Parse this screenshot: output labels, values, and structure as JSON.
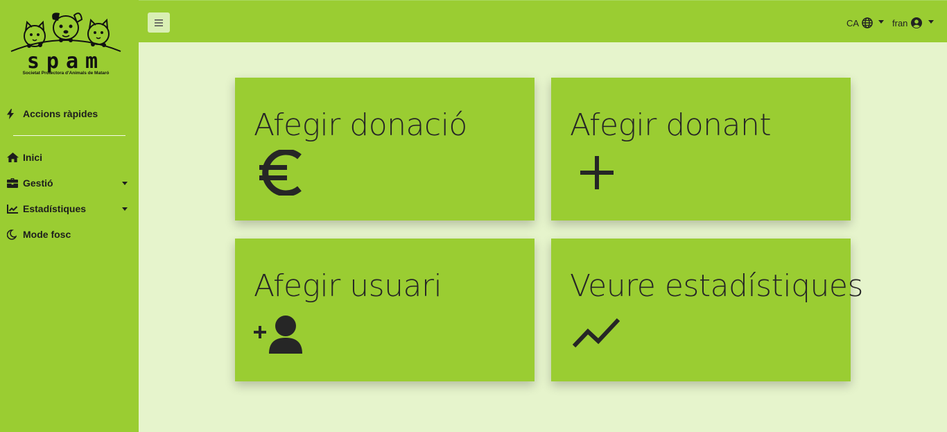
{
  "sidebar": {
    "logo": {
      "brand": "spam",
      "subtitle": "Societat Protectora d'Animals de Mataró"
    },
    "quick_actions_label": "Accions ràpides",
    "items": [
      {
        "label": "Inici",
        "icon": "home-icon"
      },
      {
        "label": "Gestió",
        "icon": "briefcase-icon",
        "dropdown": true
      },
      {
        "label": "Estadístiques",
        "icon": "chart-line-icon",
        "dropdown": true
      },
      {
        "label": "Mode fosc",
        "icon": "moon-icon"
      }
    ]
  },
  "topbar": {
    "language": "CA",
    "user": "fran"
  },
  "cards": [
    {
      "title": "Afegir donació",
      "icon": "euro-icon"
    },
    {
      "title": "Afegir donant",
      "icon": "plus-icon"
    },
    {
      "title": "Afegir usuari",
      "icon": "user-plus-icon"
    },
    {
      "title": "Veure estadístiques",
      "icon": "trend-line-icon"
    }
  ],
  "colors": {
    "accent": "#9acd32",
    "background": "#e6f4cc",
    "text": "#222222"
  }
}
